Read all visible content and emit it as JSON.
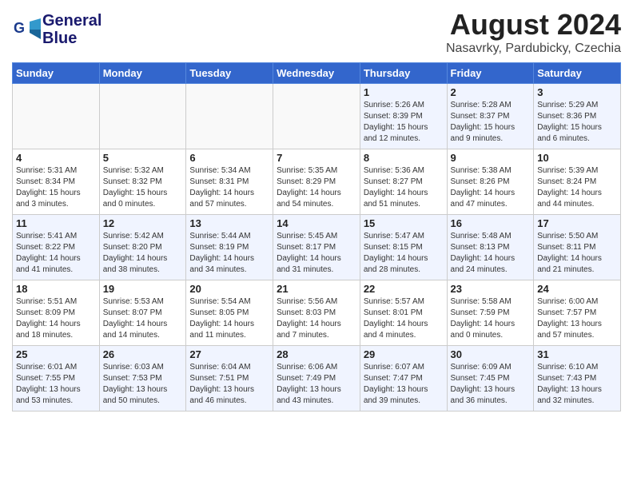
{
  "logo": {
    "line1": "General",
    "line2": "Blue"
  },
  "title": "August 2024",
  "subtitle": "Nasavrky, Pardubicky, Czechia",
  "days_of_week": [
    "Sunday",
    "Monday",
    "Tuesday",
    "Wednesday",
    "Thursday",
    "Friday",
    "Saturday"
  ],
  "weeks": [
    [
      {
        "day": "",
        "info": ""
      },
      {
        "day": "",
        "info": ""
      },
      {
        "day": "",
        "info": ""
      },
      {
        "day": "",
        "info": ""
      },
      {
        "day": "1",
        "info": "Sunrise: 5:26 AM\nSunset: 8:39 PM\nDaylight: 15 hours\nand 12 minutes."
      },
      {
        "day": "2",
        "info": "Sunrise: 5:28 AM\nSunset: 8:37 PM\nDaylight: 15 hours\nand 9 minutes."
      },
      {
        "day": "3",
        "info": "Sunrise: 5:29 AM\nSunset: 8:36 PM\nDaylight: 15 hours\nand 6 minutes."
      }
    ],
    [
      {
        "day": "4",
        "info": "Sunrise: 5:31 AM\nSunset: 8:34 PM\nDaylight: 15 hours\nand 3 minutes."
      },
      {
        "day": "5",
        "info": "Sunrise: 5:32 AM\nSunset: 8:32 PM\nDaylight: 15 hours\nand 0 minutes."
      },
      {
        "day": "6",
        "info": "Sunrise: 5:34 AM\nSunset: 8:31 PM\nDaylight: 14 hours\nand 57 minutes."
      },
      {
        "day": "7",
        "info": "Sunrise: 5:35 AM\nSunset: 8:29 PM\nDaylight: 14 hours\nand 54 minutes."
      },
      {
        "day": "8",
        "info": "Sunrise: 5:36 AM\nSunset: 8:27 PM\nDaylight: 14 hours\nand 51 minutes."
      },
      {
        "day": "9",
        "info": "Sunrise: 5:38 AM\nSunset: 8:26 PM\nDaylight: 14 hours\nand 47 minutes."
      },
      {
        "day": "10",
        "info": "Sunrise: 5:39 AM\nSunset: 8:24 PM\nDaylight: 14 hours\nand 44 minutes."
      }
    ],
    [
      {
        "day": "11",
        "info": "Sunrise: 5:41 AM\nSunset: 8:22 PM\nDaylight: 14 hours\nand 41 minutes."
      },
      {
        "day": "12",
        "info": "Sunrise: 5:42 AM\nSunset: 8:20 PM\nDaylight: 14 hours\nand 38 minutes."
      },
      {
        "day": "13",
        "info": "Sunrise: 5:44 AM\nSunset: 8:19 PM\nDaylight: 14 hours\nand 34 minutes."
      },
      {
        "day": "14",
        "info": "Sunrise: 5:45 AM\nSunset: 8:17 PM\nDaylight: 14 hours\nand 31 minutes."
      },
      {
        "day": "15",
        "info": "Sunrise: 5:47 AM\nSunset: 8:15 PM\nDaylight: 14 hours\nand 28 minutes."
      },
      {
        "day": "16",
        "info": "Sunrise: 5:48 AM\nSunset: 8:13 PM\nDaylight: 14 hours\nand 24 minutes."
      },
      {
        "day": "17",
        "info": "Sunrise: 5:50 AM\nSunset: 8:11 PM\nDaylight: 14 hours\nand 21 minutes."
      }
    ],
    [
      {
        "day": "18",
        "info": "Sunrise: 5:51 AM\nSunset: 8:09 PM\nDaylight: 14 hours\nand 18 minutes."
      },
      {
        "day": "19",
        "info": "Sunrise: 5:53 AM\nSunset: 8:07 PM\nDaylight: 14 hours\nand 14 minutes."
      },
      {
        "day": "20",
        "info": "Sunrise: 5:54 AM\nSunset: 8:05 PM\nDaylight: 14 hours\nand 11 minutes."
      },
      {
        "day": "21",
        "info": "Sunrise: 5:56 AM\nSunset: 8:03 PM\nDaylight: 14 hours\nand 7 minutes."
      },
      {
        "day": "22",
        "info": "Sunrise: 5:57 AM\nSunset: 8:01 PM\nDaylight: 14 hours\nand 4 minutes."
      },
      {
        "day": "23",
        "info": "Sunrise: 5:58 AM\nSunset: 7:59 PM\nDaylight: 14 hours\nand 0 minutes."
      },
      {
        "day": "24",
        "info": "Sunrise: 6:00 AM\nSunset: 7:57 PM\nDaylight: 13 hours\nand 57 minutes."
      }
    ],
    [
      {
        "day": "25",
        "info": "Sunrise: 6:01 AM\nSunset: 7:55 PM\nDaylight: 13 hours\nand 53 minutes."
      },
      {
        "day": "26",
        "info": "Sunrise: 6:03 AM\nSunset: 7:53 PM\nDaylight: 13 hours\nand 50 minutes."
      },
      {
        "day": "27",
        "info": "Sunrise: 6:04 AM\nSunset: 7:51 PM\nDaylight: 13 hours\nand 46 minutes."
      },
      {
        "day": "28",
        "info": "Sunrise: 6:06 AM\nSunset: 7:49 PM\nDaylight: 13 hours\nand 43 minutes."
      },
      {
        "day": "29",
        "info": "Sunrise: 6:07 AM\nSunset: 7:47 PM\nDaylight: 13 hours\nand 39 minutes."
      },
      {
        "day": "30",
        "info": "Sunrise: 6:09 AM\nSunset: 7:45 PM\nDaylight: 13 hours\nand 36 minutes."
      },
      {
        "day": "31",
        "info": "Sunrise: 6:10 AM\nSunset: 7:43 PM\nDaylight: 13 hours\nand 32 minutes."
      }
    ]
  ]
}
